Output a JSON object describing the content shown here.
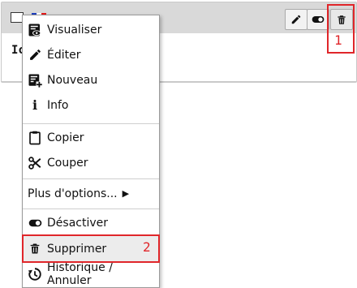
{
  "card": {
    "body_text": "Ic"
  },
  "menu": {
    "items": [
      {
        "label": "Visualiser",
        "icon": "view-icon"
      },
      {
        "label": "Éditer",
        "icon": "pencil-icon"
      },
      {
        "label": "Nouveau",
        "icon": "new-icon"
      },
      {
        "label": "Info",
        "icon": "info-icon"
      },
      {
        "label": "Copier",
        "icon": "clipboard-icon"
      },
      {
        "label": "Couper",
        "icon": "scissors-icon"
      },
      {
        "label": "Plus d'options...",
        "icon": "chevron-right-icon"
      },
      {
        "label": "Désactiver",
        "icon": "toggle-icon"
      },
      {
        "label": "Supprimer",
        "icon": "trash-icon"
      },
      {
        "label": "Historique / Annuler",
        "icon": "history-icon"
      }
    ]
  },
  "annotations": {
    "one": "1",
    "two": "2"
  },
  "colors": {
    "annotation": "#e0262a",
    "header": "#d9d9d9"
  }
}
